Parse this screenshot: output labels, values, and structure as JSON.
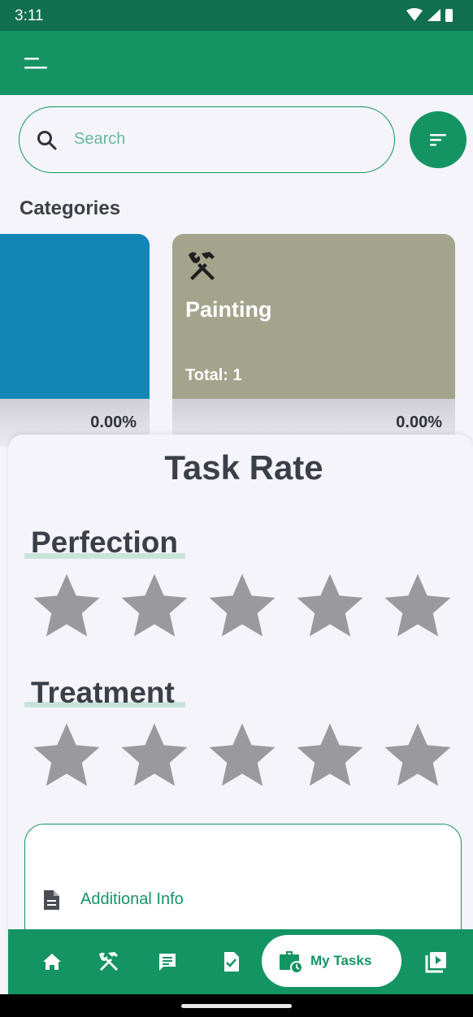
{
  "status_bar": {
    "time": "3:11"
  },
  "search": {
    "placeholder": "Search"
  },
  "categories": {
    "title": "Categories",
    "cards": [
      {
        "name": "",
        "total": "",
        "percent": "0.00%",
        "color": "#1386b8"
      },
      {
        "name": "Painting",
        "total": "Total: 1",
        "percent": "0.00%",
        "color": "#a4a48d",
        "icon": "hammer-wrench-icon"
      }
    ]
  },
  "task_rate": {
    "title": "Task Rate",
    "perfection": {
      "label": "Perfection",
      "rating": 0,
      "max": 5
    },
    "treatment": {
      "label": "Treatment",
      "rating": 0,
      "max": 5
    },
    "additional_info": {
      "label": "Additional Info",
      "icon": "document-icon"
    }
  },
  "bottom_nav": {
    "items": [
      "home-icon",
      "tools-icon",
      "chat-icon",
      "task-check-icon",
      "my-tasks-icon",
      "video-icon"
    ],
    "active_label": "My Tasks"
  },
  "colors": {
    "primary": "#149463",
    "status_bar": "#0f6f4f",
    "star_empty": "#9a9a9e",
    "text_dark": "#3a3f48"
  }
}
